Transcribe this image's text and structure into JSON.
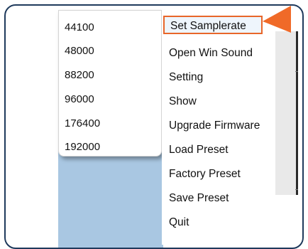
{
  "submenu": {
    "items": [
      {
        "label": "44100"
      },
      {
        "label": "48000"
      },
      {
        "label": "88200"
      },
      {
        "label": "96000"
      },
      {
        "label": "176400"
      },
      {
        "label": "192000"
      }
    ]
  },
  "menu": {
    "items": [
      {
        "label": "Set Samplerate"
      },
      {
        "label": "Open Win Sound"
      },
      {
        "label": "Setting"
      },
      {
        "label": "Show"
      },
      {
        "label": "Upgrade Firmware"
      },
      {
        "label": "Load Preset"
      },
      {
        "label": "Factory Preset"
      },
      {
        "label": "Save Preset"
      },
      {
        "label": "Quit"
      }
    ]
  },
  "colors": {
    "highlight_border": "#e8662a",
    "arrow": "#f06a28",
    "background_panel": "#a9c7e2",
    "frame_border": "#1f3a5c"
  },
  "icons": {
    "pointer": "pointer-arrow-icon"
  }
}
